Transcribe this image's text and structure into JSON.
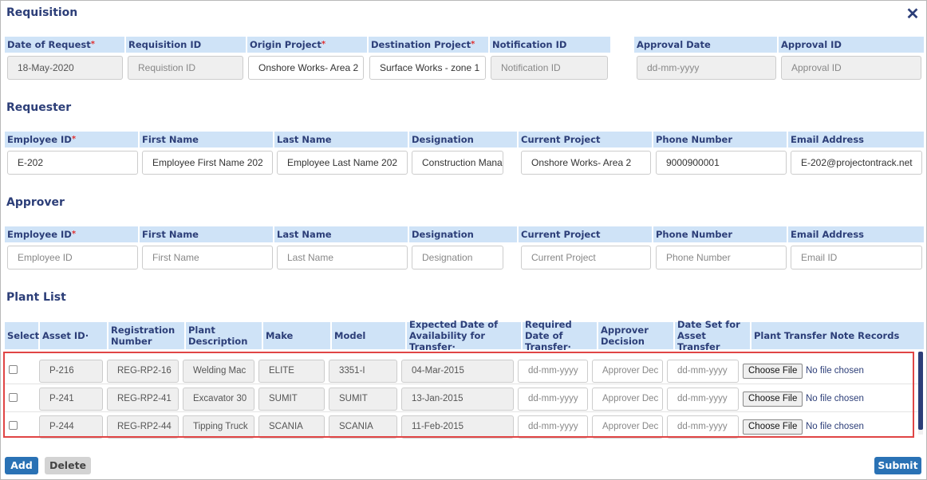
{
  "requisition": {
    "title": "Requisition",
    "headers": [
      "Date of Request",
      "Requisition ID",
      "Origin Project",
      "Destination Project",
      "Notification ID",
      "Approval Date",
      "Approval ID"
    ],
    "fields": {
      "date_of_request": "18-May-2020",
      "requisition_id_placeholder": "Requistion ID",
      "origin_project": "Onshore  Works- Area 2",
      "destination_project": "Surface Works - zone 1",
      "notification_id_placeholder": "Notification ID",
      "approval_date_placeholder": "dd-mm-yyyy",
      "approval_id_placeholder": "Approval ID"
    }
  },
  "requester": {
    "title": "Requester",
    "headers": [
      "Employee ID",
      "First Name",
      "Last Name",
      "Designation",
      "Current Project",
      "Phone Number",
      "Email Address"
    ],
    "values": [
      "E-202",
      "Employee First Name 202",
      "Employee Last Name 202",
      "Construction Mana",
      "Onshore  Works- Area 2",
      "9000900001",
      "E-202@projectontrack.net"
    ]
  },
  "approver": {
    "title": "Approver",
    "headers": [
      "Employee ID",
      "First Name",
      "Last Name",
      "Designation",
      "Current Project",
      "Phone Number",
      "Email Address"
    ],
    "placeholders": [
      "Employee ID",
      "First Name",
      "Last Name",
      "Designation",
      "Current Project",
      "Phone Number",
      "Email ID"
    ]
  },
  "plant_list": {
    "title": "Plant List",
    "headers": [
      "Select",
      "Asset ID·",
      "Registration Number",
      "Plant Description",
      "Make",
      "Model",
      "Expected Date of Availability for Transfer·",
      "Required Date of Transfer·",
      "Approver Decision",
      "Date Set for Asset Transfer",
      "Plant Transfer Note Records"
    ],
    "rows": [
      {
        "asset_id": "P-216",
        "reg": "REG-RP2-16",
        "desc": "Welding Mac",
        "make": "ELITE",
        "model": "3351-I",
        "expected": "04-Mar-2015",
        "required_ph": "dd-mm-yyyy",
        "decision_ph": "Approver Dec",
        "date_set_ph": "dd-mm-yyyy",
        "choose": "Choose File",
        "file": "No file chosen"
      },
      {
        "asset_id": "P-241",
        "reg": "REG-RP2-41",
        "desc": "Excavator 30",
        "make": "SUMIT",
        "model": "SUMIT",
        "expected": "13-Jan-2015",
        "required_ph": "dd-mm-yyyy",
        "decision_ph": "Approver Dec",
        "date_set_ph": "dd-mm-yyyy",
        "choose": "Choose File",
        "file": "No file chosen"
      },
      {
        "asset_id": "P-244",
        "reg": "REG-RP2-44",
        "desc": "Tipping Truck",
        "make": "SCANIA",
        "model": "SCANIA",
        "expected": "11-Feb-2015",
        "required_ph": "dd-mm-yyyy",
        "decision_ph": "Approver Dec",
        "date_set_ph": "dd-mm-yyyy",
        "choose": "Choose File",
        "file": "No file chosen"
      }
    ]
  },
  "footer": {
    "add": "Add",
    "delete": "Delete",
    "submit": "Submit"
  },
  "icons": {
    "close": "close-icon"
  },
  "colors": {
    "accent": "#2a72b5",
    "header_bg": "#cfe3f7",
    "title": "#2c3e78",
    "highlight": "#e04545"
  }
}
